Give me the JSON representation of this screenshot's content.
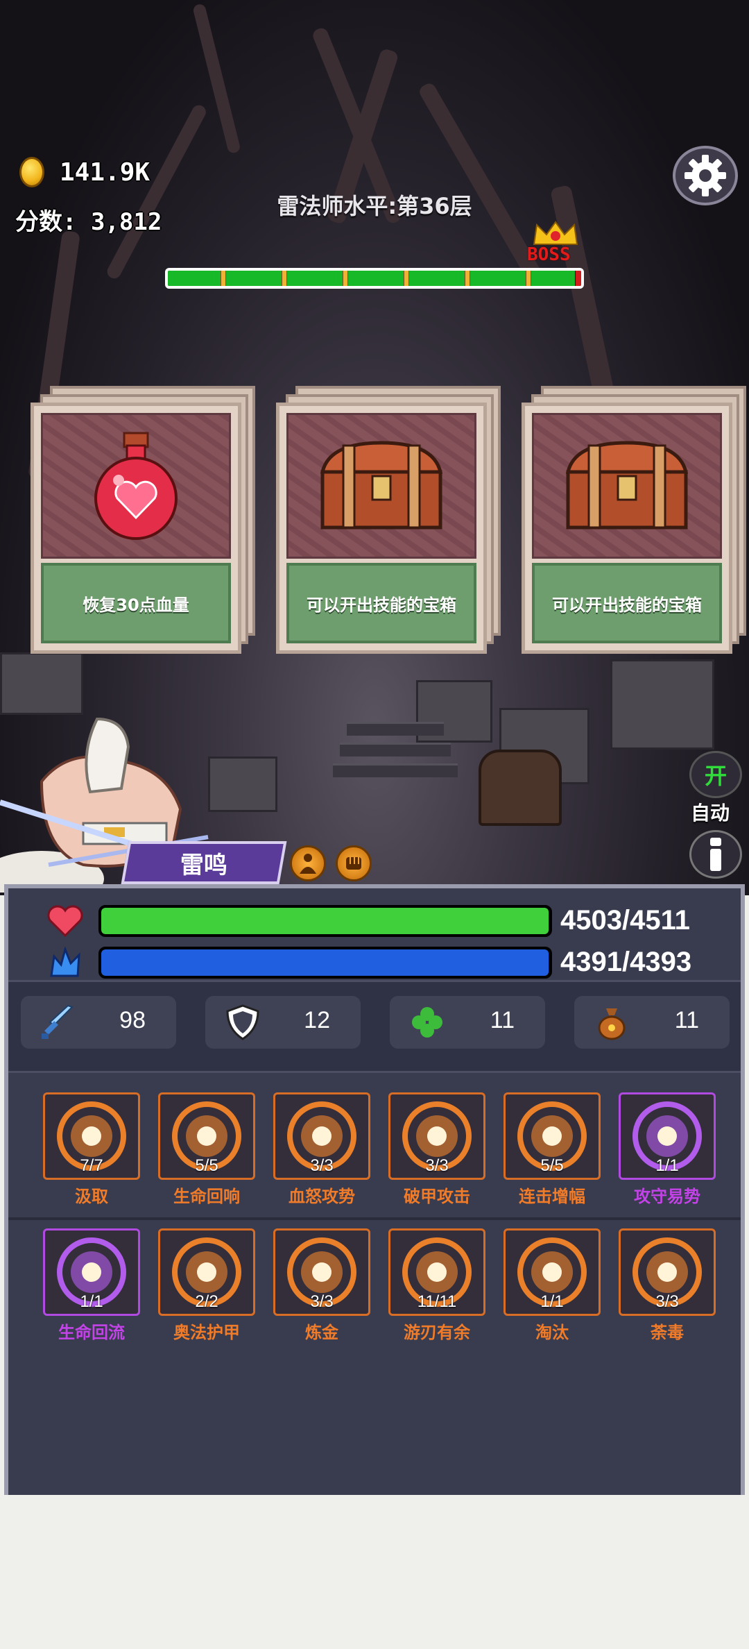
{
  "hud": {
    "gold": "141.9K",
    "score": "分数: 3,812",
    "floor_title": "雷法师水平:第36层",
    "boss_label": "BOSS",
    "progress_fraction": 0.985
  },
  "cards": [
    {
      "label": "恢复30点血量",
      "icon": "potion-icon"
    },
    {
      "label": "可以开出技能的宝箱",
      "icon": "chest-icon"
    },
    {
      "label": "可以开出技能的宝箱",
      "icon": "chest-icon"
    }
  ],
  "side": {
    "auto_toggle": "开",
    "auto_label": "自动"
  },
  "hero": {
    "name": "雷鸣"
  },
  "bars": {
    "hp": {
      "value": "4503/4511",
      "fraction": 0.998,
      "color": "#3fd03c"
    },
    "mp": {
      "value": "4391/4393",
      "fraction": 0.999,
      "color": "#1f5fe0"
    }
  },
  "stats": [
    {
      "icon": "sword-icon",
      "value": "98"
    },
    {
      "icon": "shield-icon",
      "value": "12"
    },
    {
      "icon": "clover-icon",
      "value": "11"
    },
    {
      "icon": "money-bag-icon",
      "value": "11"
    }
  ],
  "skills_row1": [
    {
      "count": "7/7",
      "name": "汲取",
      "rarity": "orange"
    },
    {
      "count": "5/5",
      "name": "生命回响",
      "rarity": "orange"
    },
    {
      "count": "3/3",
      "name": "血怒攻势",
      "rarity": "orange"
    },
    {
      "count": "3/3",
      "name": "破甲攻击",
      "rarity": "orange"
    },
    {
      "count": "5/5",
      "name": "连击增幅",
      "rarity": "orange"
    },
    {
      "count": "1/1",
      "name": "攻守易势",
      "rarity": "purple"
    }
  ],
  "skills_row2": [
    {
      "count": "1/1",
      "name": "生命回流",
      "rarity": "purple"
    },
    {
      "count": "2/2",
      "name": "奥法护甲",
      "rarity": "orange"
    },
    {
      "count": "3/3",
      "name": "炼金",
      "rarity": "orange"
    },
    {
      "count": "11/11",
      "name": "游刃有余",
      "rarity": "orange"
    },
    {
      "count": "1/1",
      "name": "淘汰",
      "rarity": "orange"
    },
    {
      "count": "3/3",
      "name": "荼毒",
      "rarity": "orange"
    }
  ]
}
